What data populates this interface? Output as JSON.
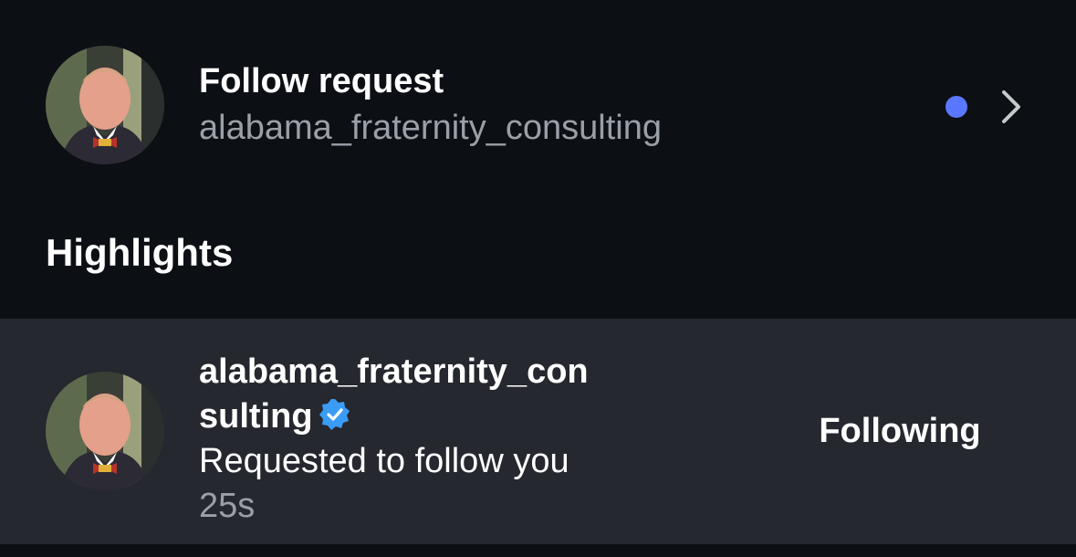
{
  "follow_request": {
    "title": "Follow request",
    "username": "alabama_fraternity_consulting",
    "unread_dot_color": "#5a78ff",
    "avatar_icon": "profile-photo",
    "chevron_icon": "chevron-right-icon"
  },
  "highlights": {
    "section_title": "Highlights",
    "items": [
      {
        "username": "alabama_fraternity_consulting",
        "verified": true,
        "verified_color": "#3b9cf5",
        "activity": "Requested to follow you",
        "time": "25s",
        "action_label": "Following"
      }
    ]
  }
}
